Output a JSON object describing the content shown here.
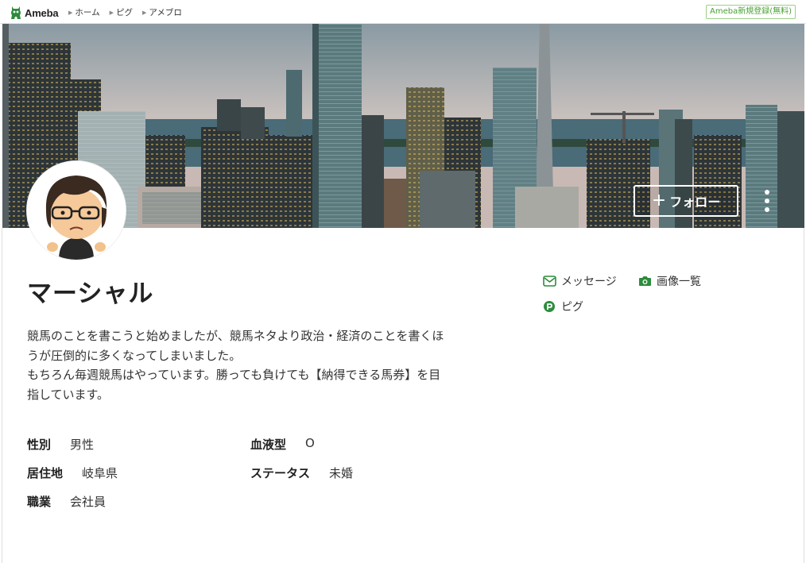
{
  "header": {
    "logo_text": "Ameba",
    "breadcrumbs": [
      "ホーム",
      "ピグ",
      "アメブロ"
    ],
    "signup_label": "Ameba新規登録(無料)"
  },
  "profile": {
    "name": "マーシャル",
    "follow_label": "フォロー",
    "actions": {
      "message": "メッセージ",
      "images": "画像一覧",
      "pigg": "ピグ"
    },
    "bio": [
      "競馬のことを書こうと始めましたが、競馬ネタより政治・経済のことを書くほ",
      "うが圧倒的に多くなってしまいました。",
      "もちろん毎週競馬はやっています。勝っても負けても【納得できる馬券】を目",
      "指しています。"
    ],
    "attributes": {
      "gender": {
        "label": "性別",
        "value": "男性"
      },
      "blood": {
        "label": "血液型",
        "value": "O"
      },
      "residence": {
        "label": "居住地",
        "value": "岐阜県"
      },
      "status": {
        "label": "ステータス",
        "value": "未婚"
      },
      "job": {
        "label": "職業",
        "value": "会社員"
      }
    }
  },
  "colors": {
    "brand_green": "#2d8c3c",
    "signup_border": "#9ccf8a"
  },
  "icons": {
    "logo": "ameba-logo-icon",
    "message": "mail-icon",
    "images": "camera-icon",
    "pigg": "pigg-icon",
    "more": "more-vertical-icon"
  }
}
